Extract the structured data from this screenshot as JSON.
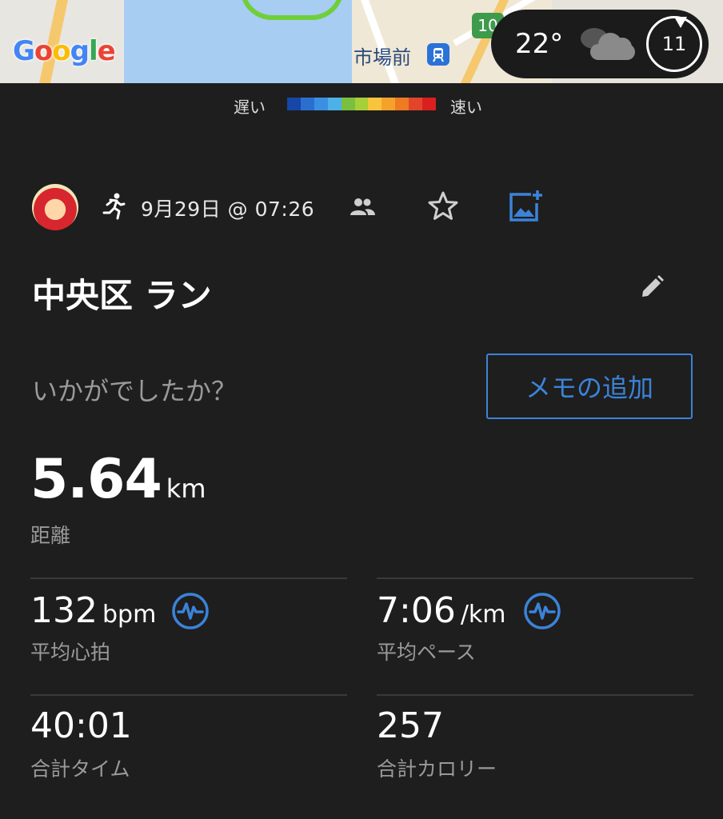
{
  "map": {
    "station_name": "市場前",
    "station_icon": "train-icon",
    "route_badge": "10",
    "google_letters": [
      "G",
      "o",
      "o",
      "g",
      "l",
      "e"
    ]
  },
  "weather": {
    "temperature": "22°",
    "condition_icon": "cloud-icon",
    "wind_speed": "11"
  },
  "legend": {
    "slow_label": "遅い",
    "fast_label": "速い",
    "colors": [
      "#1646a8",
      "#2a6fd0",
      "#3b8fe3",
      "#4db0e6",
      "#7ac040",
      "#a6cf38",
      "#f7c43c",
      "#f4a22c",
      "#ee7a22",
      "#e2452a",
      "#d9201f"
    ]
  },
  "activity": {
    "type_icon": "run-icon",
    "date_time": "9月29日 @ 07:26",
    "title": "中央区 ラン",
    "prompt": "いかがでしたか？",
    "memo_button": "メモの追加"
  },
  "distance": {
    "value": "5.64",
    "unit": "km",
    "label": "距離"
  },
  "stats": {
    "heart_rate": {
      "value": "132",
      "unit": "bpm",
      "label": "平均心拍"
    },
    "pace": {
      "value": "7:06",
      "unit": "/km",
      "label": "平均ペース"
    },
    "total_time": {
      "value": "40:01",
      "label": "合計タイム"
    },
    "calories": {
      "value": "257",
      "label": "合計カロリー"
    }
  },
  "colors": {
    "background": "#1e1e1e",
    "accent": "#3b83d8",
    "secondary_text": "#9a9a9a"
  }
}
